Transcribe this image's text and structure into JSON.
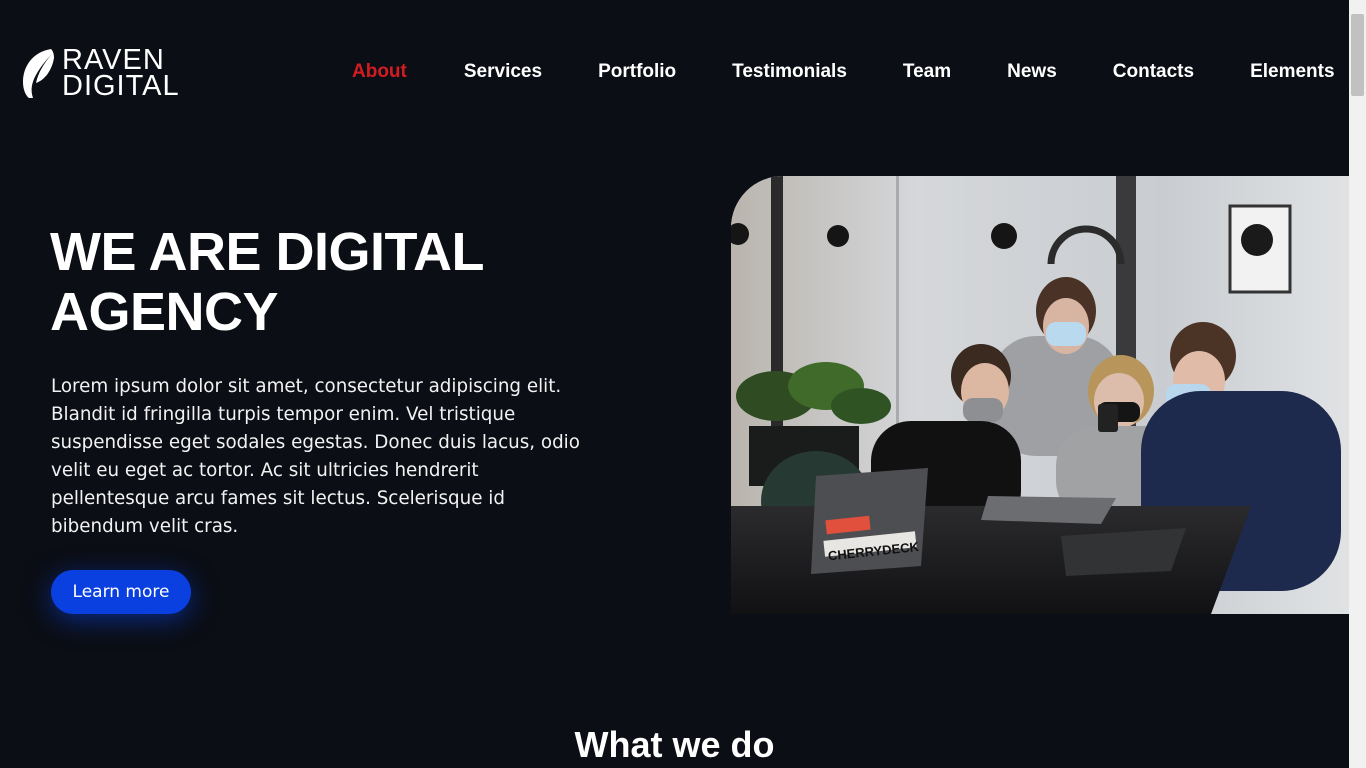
{
  "header": {
    "logo": {
      "line1": "RAVEN",
      "line2": "DIGITAL",
      "icon": "feather-icon"
    },
    "nav": [
      {
        "label": "About",
        "active": true
      },
      {
        "label": "Services",
        "active": false
      },
      {
        "label": "Portfolio",
        "active": false
      },
      {
        "label": "Testimonials",
        "active": false
      },
      {
        "label": "Team",
        "active": false
      },
      {
        "label": "News",
        "active": false
      },
      {
        "label": "Contacts",
        "active": false
      },
      {
        "label": "Elements",
        "active": false
      }
    ]
  },
  "hero": {
    "title_line1": "WE ARE DIGITAL",
    "title_line2": "AGENCY",
    "text": "Lorem ipsum dolor sit amet, consectetur adipiscing elit. Blandit id fringilla turpis tempor enim. Vel tristique suspendisse eget sodales egestas. Donec duis lacus, odio velit eu eget ac tortor. Ac sit ultricies hendrerit pellentesque arcu fames sit lectus. Scelerisque id bibendum velit cras.",
    "cta_label": "Learn more",
    "image_laptop_sticker": "CHERRYDECK"
  },
  "section": {
    "title": "What we do"
  },
  "colors": {
    "background": "#0b0e15",
    "accent_red": "#d31c22",
    "button_blue": "#0a3fe0",
    "text": "#ffffff"
  }
}
